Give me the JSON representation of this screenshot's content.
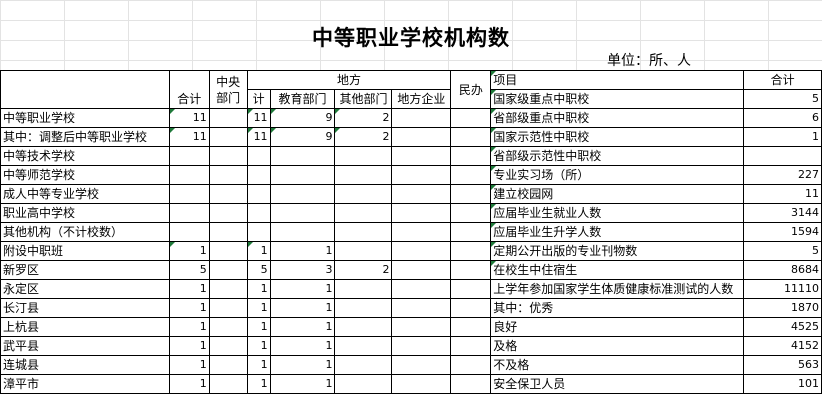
{
  "title": "中等职业学校机构数",
  "unit_label": "单位：所、人",
  "left_headers": {
    "total": "合计",
    "central": "中央部门",
    "local": "地方",
    "local_sub": [
      "计",
      "教育部门",
      "其他部门",
      "地方企业"
    ],
    "private": "民办"
  },
  "right_headers": {
    "item": "项目",
    "total": "合计"
  },
  "left_rows": [
    {
      "label": "中等职业学校",
      "total": "11",
      "central": "",
      "ji": "11",
      "edu": "9",
      "other": "2",
      "ent": "",
      "private": ""
    },
    {
      "label": "其中：调整后中等职业学校",
      "total": "11",
      "central": "",
      "ji": "11",
      "edu": "9",
      "other": "2",
      "ent": "",
      "private": ""
    },
    {
      "label": "中等技术学校",
      "total": "",
      "central": "",
      "ji": "",
      "edu": "",
      "other": "",
      "ent": "",
      "private": ""
    },
    {
      "label": "中等师范学校",
      "total": "",
      "central": "",
      "ji": "",
      "edu": "",
      "other": "",
      "ent": "",
      "private": ""
    },
    {
      "label": "成人中等专业学校",
      "total": "",
      "central": "",
      "ji": "",
      "edu": "",
      "other": "",
      "ent": "",
      "private": ""
    },
    {
      "label": "职业高中学校",
      "total": "",
      "central": "",
      "ji": "",
      "edu": "",
      "other": "",
      "ent": "",
      "private": ""
    },
    {
      "label": "其他机构（不计校数）",
      "total": "",
      "central": "",
      "ji": "",
      "edu": "",
      "other": "",
      "ent": "",
      "private": ""
    },
    {
      "label": "附设中职班",
      "total": "1",
      "central": "",
      "ji": "1",
      "edu": "1",
      "other": "",
      "ent": "",
      "private": ""
    },
    {
      "label": "新罗区",
      "total": "5",
      "central": "",
      "ji": "5",
      "edu": "3",
      "other": "2",
      "ent": "",
      "private": ""
    },
    {
      "label": "永定区",
      "total": "1",
      "central": "",
      "ji": "1",
      "edu": "1",
      "other": "",
      "ent": "",
      "private": ""
    },
    {
      "label": "长汀县",
      "total": "1",
      "central": "",
      "ji": "1",
      "edu": "1",
      "other": "",
      "ent": "",
      "private": ""
    },
    {
      "label": "上杭县",
      "total": "1",
      "central": "",
      "ji": "1",
      "edu": "1",
      "other": "",
      "ent": "",
      "private": ""
    },
    {
      "label": "武平县",
      "total": "1",
      "central": "",
      "ji": "1",
      "edu": "1",
      "other": "",
      "ent": "",
      "private": ""
    },
    {
      "label": "连城县",
      "total": "1",
      "central": "",
      "ji": "1",
      "edu": "1",
      "other": "",
      "ent": "",
      "private": ""
    },
    {
      "label": "漳平市",
      "total": "1",
      "central": "",
      "ji": "1",
      "edu": "1",
      "other": "",
      "ent": "",
      "private": ""
    }
  ],
  "right_rows": [
    {
      "item": "国家级重点中职校",
      "total": "5"
    },
    {
      "item": "省部级重点中职校",
      "total": "6"
    },
    {
      "item": "国家示范性中职校",
      "total": "1"
    },
    {
      "item": "省部级示范性中职校",
      "total": ""
    },
    {
      "item": "专业实习场（所）",
      "total": "227"
    },
    {
      "item": "建立校园网",
      "total": "11"
    },
    {
      "item": "应届毕业生就业人数",
      "total": "3144"
    },
    {
      "item": "应届毕业生升学人数",
      "total": "1594"
    },
    {
      "item": "定期公开出版的专业刊物数",
      "total": "5"
    },
    {
      "item": "在校生中住宿生",
      "total": "8684"
    },
    {
      "item": "上学年参加国家学生体质健康标准测试的人数",
      "total": "11110"
    },
    {
      "item": "其中：优秀",
      "total": "1870"
    },
    {
      "item": "良好",
      "total": "4525"
    },
    {
      "item": "及格",
      "total": "4152"
    },
    {
      "item": "不及格",
      "total": "563"
    },
    {
      "item": "安全保卫人员",
      "total": "101"
    }
  ],
  "colors": {
    "grid_line": "#000000",
    "comment_marker": "#1f7a3a",
    "bg_grid": "#e3e3e3"
  }
}
